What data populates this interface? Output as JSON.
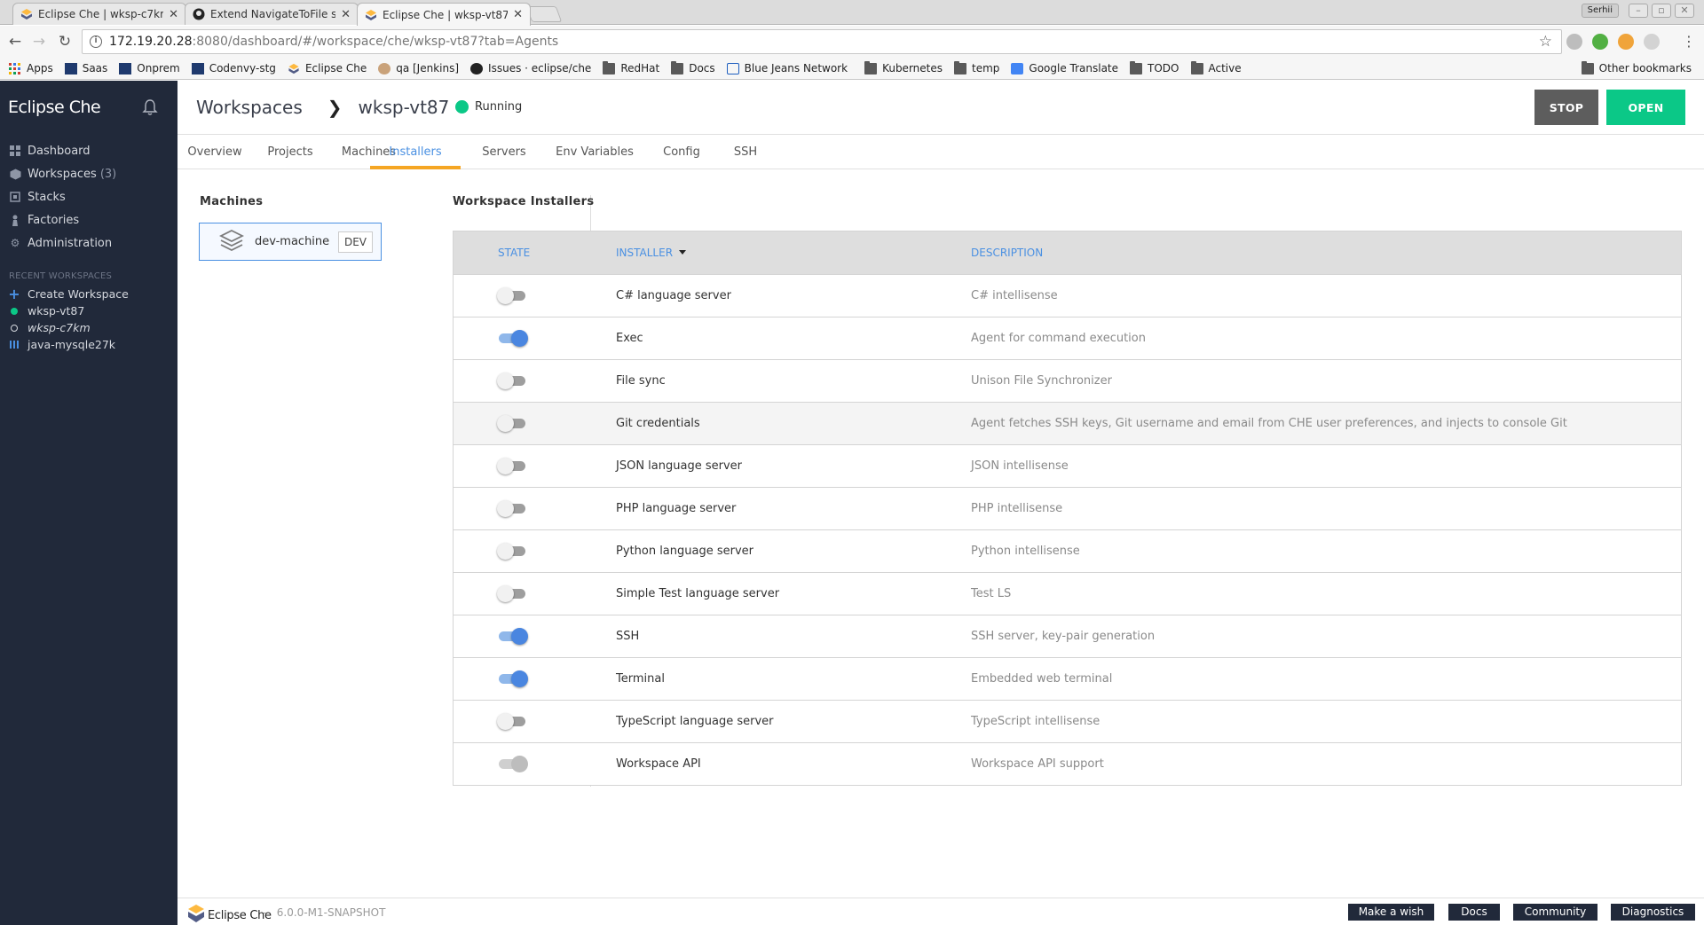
{
  "browser": {
    "tabs": [
      {
        "title": "Eclipse Che | wksp-c7km",
        "active": false
      },
      {
        "title": "Extend NavigateToFile s",
        "active": false
      },
      {
        "title": "Eclipse Che | wksp-vt87",
        "active": true
      }
    ],
    "user": "Serhii",
    "url_host": "172.19.20.28",
    "url_path": ":8080/dashboard/#/workspace/che/wksp-vt87?tab=Agents",
    "bookmarks": [
      "Apps",
      "Saas",
      "Onprem",
      "Codenvy-stg",
      "Eclipse Che",
      "qa [Jenkins]",
      "Issues · eclipse/che",
      "RedHat",
      "Docs",
      "Blue Jeans Network",
      "Kubernetes",
      "temp",
      "Google Translate",
      "TODO",
      "Active"
    ],
    "other_bookmarks": "Other bookmarks"
  },
  "sidebar": {
    "brand": "Eclipse Che",
    "nav": [
      {
        "label": "Dashboard",
        "icon": "dashboard-icon"
      },
      {
        "label": "Workspaces",
        "count": "(3)",
        "icon": "workspaces-icon"
      },
      {
        "label": "Stacks",
        "icon": "stacks-icon"
      },
      {
        "label": "Factories",
        "icon": "factories-icon"
      },
      {
        "label": "Administration",
        "icon": "gear-icon"
      }
    ],
    "recent_header": "RECENT WORKSPACES",
    "recent": [
      {
        "label": "Create Workspace"
      },
      {
        "label": "wksp-vt87"
      },
      {
        "label": "wksp-c7km"
      },
      {
        "label": "java-mysqle27k"
      }
    ]
  },
  "header": {
    "section": "Workspaces",
    "workspace": "wksp-vt87",
    "status": "Running",
    "stop_label": "STOP",
    "open_label": "OPEN"
  },
  "tabs": [
    "Overview",
    "Projects",
    "Machines",
    "Installers",
    "Servers",
    "Env Variables",
    "Config",
    "SSH"
  ],
  "machines": {
    "heading": "Machines",
    "items": [
      {
        "name": "dev-machine",
        "tag": "DEV"
      }
    ]
  },
  "installers": {
    "heading": "Workspace Installers",
    "columns": {
      "state": "STATE",
      "installer": "INSTALLER",
      "description": "DESCRIPTION"
    },
    "rows": [
      {
        "name": "C# language server",
        "description": "C# intellisense",
        "state": "off"
      },
      {
        "name": "Exec",
        "description": "Agent for command execution",
        "state": "on"
      },
      {
        "name": "File sync",
        "description": "Unison File Synchronizer",
        "state": "off"
      },
      {
        "name": "Git credentials",
        "description": "Agent fetches SSH keys, Git username and email from CHE user preferences, and injects to console Git",
        "state": "off"
      },
      {
        "name": "JSON language server",
        "description": "JSON intellisense",
        "state": "off"
      },
      {
        "name": "PHP language server",
        "description": "PHP intellisense",
        "state": "off"
      },
      {
        "name": "Python language server",
        "description": "Python intellisense",
        "state": "off"
      },
      {
        "name": "Simple Test language server",
        "description": "Test LS",
        "state": "off"
      },
      {
        "name": "SSH",
        "description": "SSH server, key-pair generation",
        "state": "on"
      },
      {
        "name": "Terminal",
        "description": "Embedded web terminal",
        "state": "on"
      },
      {
        "name": "TypeScript language server",
        "description": "TypeScript intellisense",
        "state": "off"
      },
      {
        "name": "Workspace API",
        "description": "Workspace API support",
        "state": "disabled"
      }
    ]
  },
  "footer": {
    "brand": "Eclipse Che",
    "version": "6.0.0-M1-SNAPSHOT",
    "buttons": [
      "Make a wish",
      "Docs",
      "Community",
      "Diagnostics"
    ]
  },
  "colors": {
    "sidebar_bg": "#21293a",
    "accent_blue": "#4a90e2",
    "running_green": "#0bc887",
    "tab_underline": "#f5a623",
    "stop_gray": "#5d5d5d"
  }
}
